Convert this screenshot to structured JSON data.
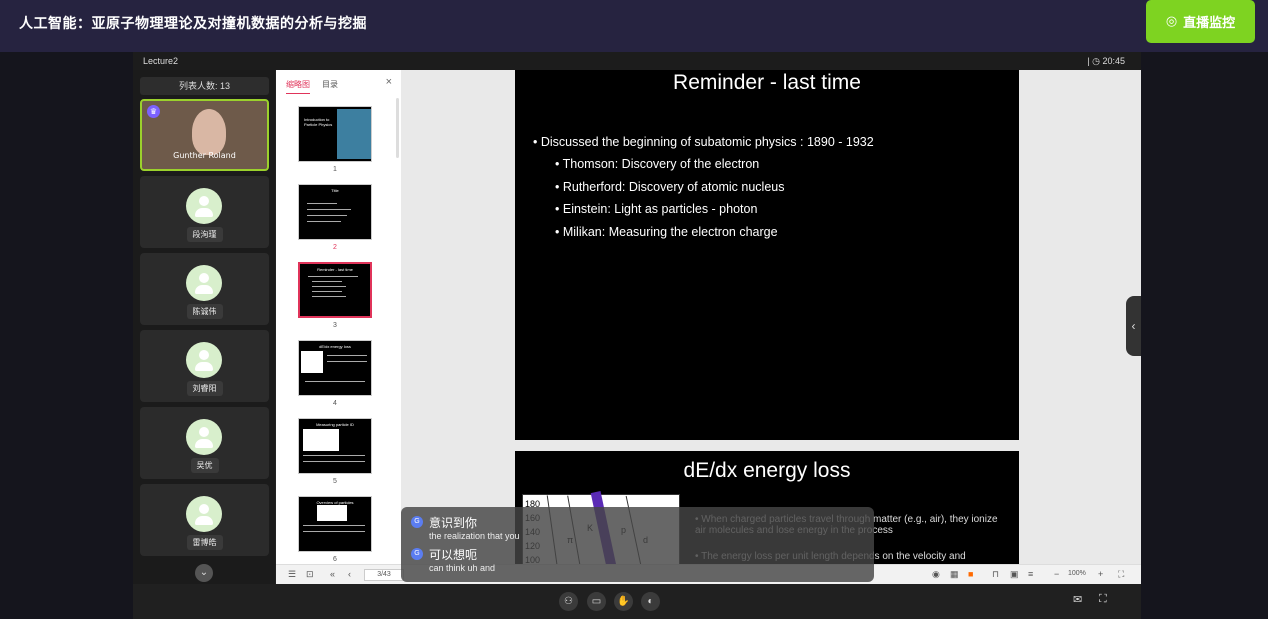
{
  "header": {
    "title": "人工智能：亚原子物理理论及对撞机数据的分析与挖掘",
    "monitor_label": "直播监控"
  },
  "stage": {
    "lecture_name": "Lecture2",
    "clock": "| ◷ 20:45"
  },
  "participants": {
    "count_label": "列表人数: 13",
    "tiles": [
      {
        "name": "Gunther Roland"
      },
      {
        "name": "段洵瑾"
      },
      {
        "name": "陈诚伟"
      },
      {
        "name": "刘睿阳"
      },
      {
        "name": "吴优"
      },
      {
        "name": "雷博皓"
      }
    ]
  },
  "thumbnails": {
    "tab_thumbs": "缩略图",
    "tab_toc": "目录",
    "close": "×",
    "items": [
      {
        "num": "1",
        "title": "Introduction to Particle Physics"
      },
      {
        "num": "2",
        "title": "Title"
      },
      {
        "num": "3",
        "title": "Reminder - last time"
      },
      {
        "num": "4",
        "title": "dE/dx energy loss"
      },
      {
        "num": "5",
        "title": "Measuring particle ID"
      },
      {
        "num": "6",
        "title": "Overview of particles"
      }
    ]
  },
  "footer": {
    "page": "3/43",
    "zoom": "100%"
  },
  "slide1": {
    "title": "Reminder - last time",
    "bullets": [
      "Discussed the beginning of subatomic physics : 1890 - 1932",
      "Thomson: Discovery of the electron",
      "Rutherford: Discovery of atomic nucleus",
      "Einstein: Light as particles - photon",
      "Milikan: Measuring the electron charge"
    ]
  },
  "slide2": {
    "title": "dE/dx energy loss",
    "plot_y_ticks": [
      "180",
      "160",
      "140",
      "120",
      "100"
    ],
    "plot_labels": [
      "K",
      "p",
      "π",
      "d"
    ],
    "bullets": [
      "When charged particles travel through matter (e.g., air), they ionize air molecules and lose energy in the process",
      "The energy loss per unit length depends on the velocity and"
    ]
  },
  "captions": [
    {
      "zh": "意识到你",
      "en": "the realization that you"
    },
    {
      "zh": "可以想呃",
      "en": "can think uh and"
    }
  ]
}
